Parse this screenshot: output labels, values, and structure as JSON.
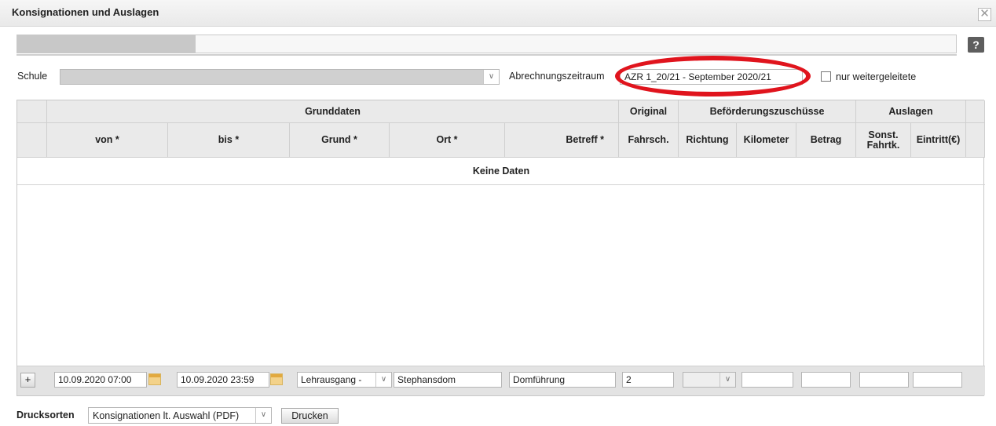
{
  "window": {
    "title": "Konsignationen und Auslagen",
    "close_symbol": "✕"
  },
  "progress": {
    "fraction": 0.19
  },
  "help": {
    "symbol": "?"
  },
  "filters": {
    "schule_label": "Schule",
    "schule_value": "",
    "period_label": "Abrechnungszeitraum",
    "period_value": "AZR 1_20/21 - September 2020/21",
    "forwarded_label": "nur weitergeleitete",
    "forwarded_checked": false
  },
  "table": {
    "group_headers": {
      "grunddaten": "Grunddaten",
      "original": "Original",
      "befoerderung": "Beförderungszuschüsse",
      "auslagen": "Auslagen"
    },
    "columns": {
      "von": "von *",
      "bis": "bis *",
      "grund": "Grund *",
      "ort": "Ort *",
      "betreff": "Betreff *",
      "fahrsch": "Fahrsch.",
      "richtung": "Richtung",
      "kilometer": "Kilometer",
      "betrag": "Betrag",
      "sonst": "Sonst. Fahrtk.",
      "eintritt": "Eintritt(€)"
    },
    "empty_text": "Keine Daten",
    "new_row": {
      "add_label": "+",
      "von": "10.09.2020 07:00",
      "bis": "10.09.2020 23:59",
      "grund": "Lehrausgang -",
      "ort": "Stephansdom",
      "betreff": "Domführung",
      "fahrsch": "2",
      "richtung": "",
      "kilometer": "",
      "betrag": "",
      "sonst": "",
      "eintritt": ""
    }
  },
  "bottom": {
    "drucksorten_label": "Drucksorten",
    "drucksorten_value": "Konsignationen lt. Auswahl (PDF)",
    "print_label": "Drucken"
  },
  "colors": {
    "highlight_oval": "#e0141d",
    "header_bg": "#eaeaea",
    "footer_bg": "#e3e3e3"
  }
}
